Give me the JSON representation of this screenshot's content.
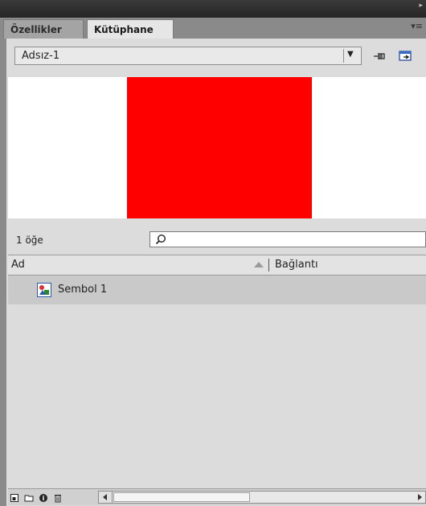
{
  "tabs": [
    {
      "label": "Özellikler",
      "active": false
    },
    {
      "label": "Kütüphane",
      "active": true
    }
  ],
  "library": {
    "document": "Adsız-1",
    "preview_color": "#ff0000",
    "item_count": "1 öğe",
    "search_placeholder": "",
    "columns": {
      "name": "Ad",
      "linkage": "Bağlantı"
    },
    "items": [
      {
        "name": "Sembol 1",
        "icon": "movieclip-symbol-icon"
      }
    ]
  },
  "icons": [
    "panel-collapse-icon",
    "panel-menu-icon",
    "dropdown-arrow-icon",
    "pin-library-icon",
    "new-library-panel-icon",
    "search-icon",
    "sort-ascending-icon",
    "new-symbol-icon",
    "new-folder-icon",
    "properties-icon",
    "delete-icon"
  ]
}
